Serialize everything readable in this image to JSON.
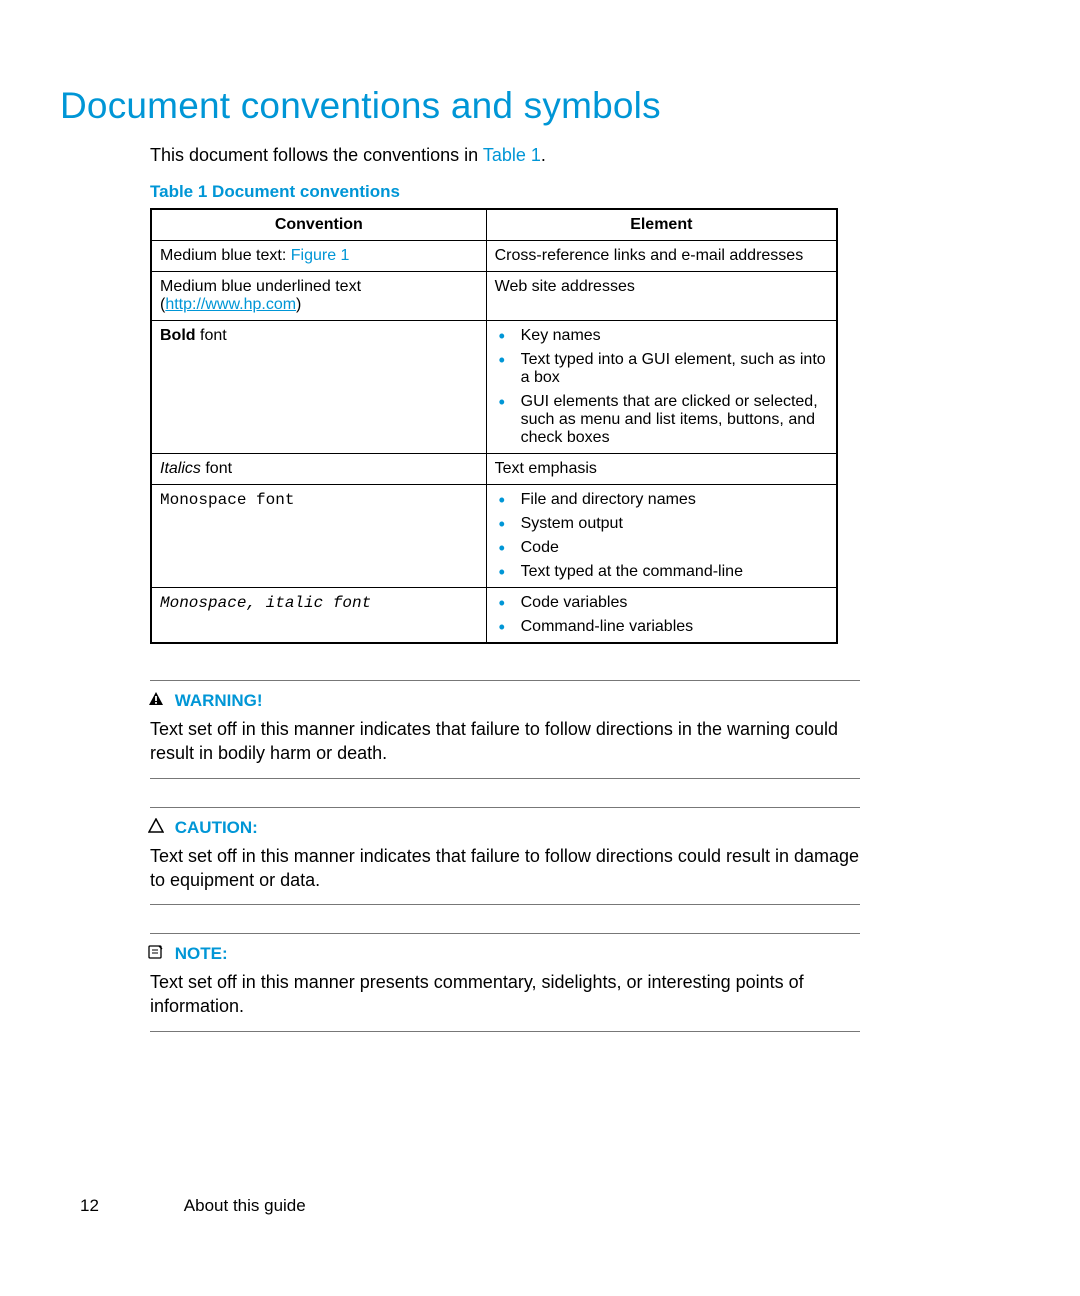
{
  "title": "Document conventions and symbols",
  "intro_prefix": "This document follows the conventions in ",
  "intro_link": "Table 1",
  "intro_suffix": ".",
  "table_caption": "Table 1 Document conventions",
  "headers": {
    "convention": "Convention",
    "element": "Element"
  },
  "rows": {
    "r1": {
      "conv_prefix": "Medium blue text: ",
      "conv_link": "Figure 1",
      "elem": "Cross-reference links and e-mail addresses"
    },
    "r2": {
      "conv_prefix": "Medium blue underlined text (",
      "conv_link": "http://www.hp.com",
      "conv_suffix": ")",
      "elem": "Web site addresses"
    },
    "r3": {
      "conv_bold": "Bold",
      "conv_suffix": " font",
      "b1": "Key names",
      "b2": "Text typed into a GUI element, such as into a box",
      "b3": "GUI elements that are clicked or selected, such as menu and list items, buttons, and check boxes"
    },
    "r4": {
      "conv_italic": "Italics",
      "conv_suffix": " font",
      "elem": "Text emphasis"
    },
    "r5": {
      "conv": "Monospace font",
      "b1": "File and directory names",
      "b2": "System output",
      "b3": "Code",
      "b4": "Text typed at the command-line"
    },
    "r6": {
      "conv": "Monospace, italic font",
      "b1": "Code variables",
      "b2": "Command-line variables"
    }
  },
  "callouts": {
    "warning": {
      "head": "WARNING!",
      "body": "Text set off in this manner indicates that failure to follow directions in the warning could result in bodily harm or death."
    },
    "caution": {
      "head": "CAUTION:",
      "body": "Text set off in this manner indicates that failure to follow directions could result in damage to equipment or data."
    },
    "note": {
      "head": "NOTE:",
      "body": "Text set off in this manner presents commentary, sidelights, or interesting points of information."
    }
  },
  "footer": {
    "page": "12",
    "section": "About this guide"
  }
}
